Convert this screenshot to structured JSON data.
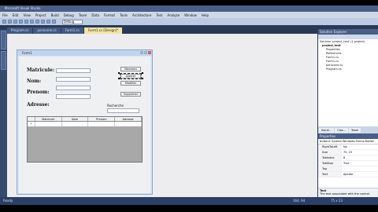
{
  "window": {
    "title": "Microsoft Visual Studio"
  },
  "menu": [
    "File",
    "Edit",
    "View",
    "Project",
    "Build",
    "Debug",
    "Team",
    "Data",
    "Format",
    "Tools",
    "Architecture",
    "Test",
    "Analyze",
    "Window",
    "Help"
  ],
  "toolbar": {
    "config": "Debug"
  },
  "doc_tabs": [
    "Program.cs",
    "personne.cs",
    "Form1.cs",
    "Form1.cs [Design]*"
  ],
  "form": {
    "title": "Form1",
    "labels": {
      "matricule": "Matricule:",
      "nom": "Nom:",
      "prenom": "Prenom:",
      "adresse": "Adresse:",
      "recherche": "Recherche"
    },
    "buttons": {
      "b1": "Nouveau",
      "b2": "Ajouter",
      "b3": "Modifier",
      "b4": "Supprimer"
    },
    "grid_columns": [
      "Matricule",
      "Nom",
      "Prenom",
      "Adresse"
    ],
    "grid_row_marker": "*"
  },
  "solution_explorer": {
    "title": "Solution Explorer",
    "items": [
      "Solution 'project_test' (1 project)",
      "project_test",
      "Properties",
      "References",
      "Form1.cs",
      "Form1.cs",
      "personne.cs",
      "Program.cs"
    ]
  },
  "panel_tabs": [
    "Soluti...",
    "Clas...",
    "Team"
  ],
  "properties": {
    "title": "Properties",
    "object": "button2 System.Windows.Forms.Button",
    "rows": [
      {
        "k": "RightToLeft",
        "v": "No"
      },
      {
        "k": "Size",
        "v": "75, 23"
      },
      {
        "k": "TabIndex",
        "v": "8"
      },
      {
        "k": "TabStop",
        "v": "True"
      },
      {
        "k": "Tag",
        "v": ""
      },
      {
        "k": "Text",
        "v": "Ajouter"
      }
    ],
    "desc_title": "Text",
    "desc_body": "The text associated with the control."
  },
  "status": {
    "left": "Ready",
    "mid": "164, 94",
    "right": "75 x 23"
  }
}
